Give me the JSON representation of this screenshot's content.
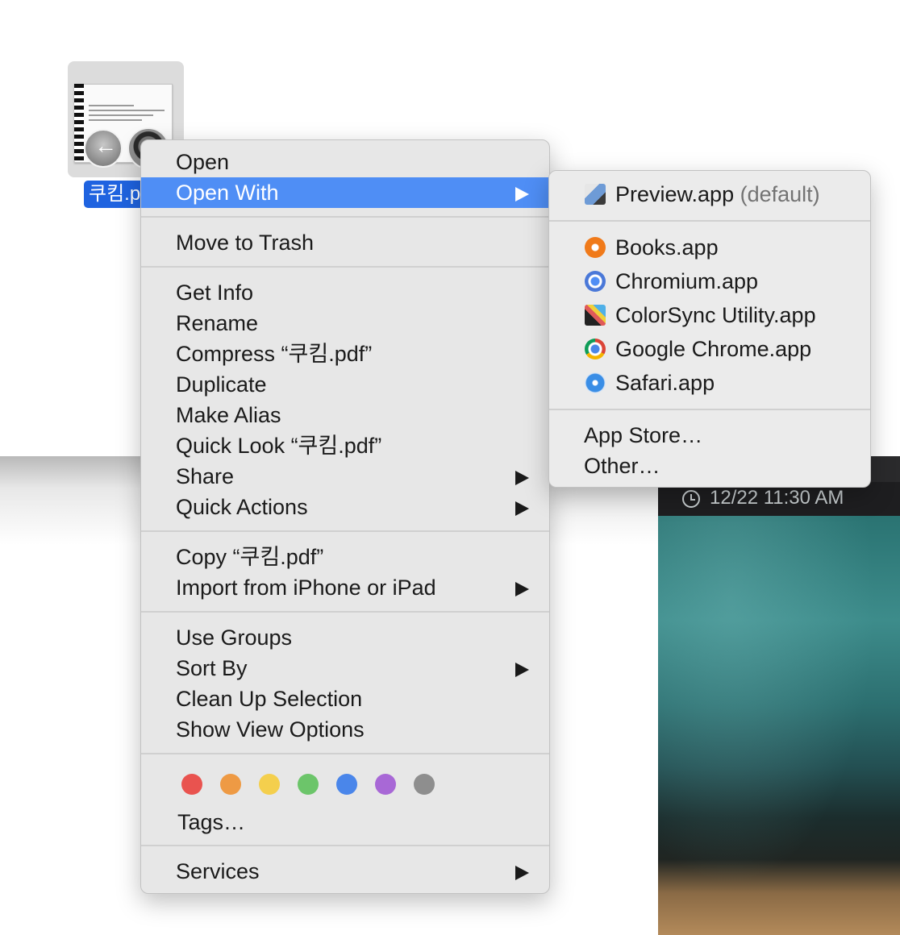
{
  "desktop": {
    "file": {
      "name_visible": "쿠킴.p"
    },
    "photo_window": {
      "timestamp": "12/22 11:30 AM"
    }
  },
  "context_menu": {
    "groups": [
      [
        {
          "label": "Open",
          "submenu": false,
          "highlighted": false
        },
        {
          "label": "Open With",
          "submenu": true,
          "highlighted": true
        }
      ],
      [
        {
          "label": "Move to Trash",
          "submenu": false,
          "highlighted": false
        }
      ],
      [
        {
          "label": "Get Info",
          "submenu": false,
          "highlighted": false
        },
        {
          "label": "Rename",
          "submenu": false,
          "highlighted": false
        },
        {
          "label": "Compress “쿠킴.pdf”",
          "submenu": false,
          "highlighted": false
        },
        {
          "label": "Duplicate",
          "submenu": false,
          "highlighted": false
        },
        {
          "label": "Make Alias",
          "submenu": false,
          "highlighted": false
        },
        {
          "label": "Quick Look “쿠킴.pdf”",
          "submenu": false,
          "highlighted": false
        },
        {
          "label": "Share",
          "submenu": true,
          "highlighted": false
        },
        {
          "label": "Quick Actions",
          "submenu": true,
          "highlighted": false
        }
      ],
      [
        {
          "label": "Copy “쿠킴.pdf”",
          "submenu": false,
          "highlighted": false
        },
        {
          "label": "Import from iPhone or iPad",
          "submenu": true,
          "highlighted": false
        }
      ],
      [
        {
          "label": "Use Groups",
          "submenu": false,
          "highlighted": false
        },
        {
          "label": "Sort By",
          "submenu": true,
          "highlighted": false
        },
        {
          "label": "Clean Up Selection",
          "submenu": false,
          "highlighted": false
        },
        {
          "label": "Show View Options",
          "submenu": false,
          "highlighted": false
        }
      ]
    ],
    "tags": {
      "colors": [
        "#e9534f",
        "#ee9a44",
        "#f4cf4d",
        "#6cc56a",
        "#4a86ea",
        "#a868d6",
        "#8e8e8e"
      ],
      "label": "Tags…"
    },
    "services": {
      "label": "Services",
      "submenu": true
    }
  },
  "open_with_submenu": {
    "default_app": {
      "name": "Preview.app",
      "note": "(default)",
      "icon": "preview-icon"
    },
    "apps": [
      {
        "name": "Books.app",
        "icon": "books-icon"
      },
      {
        "name": "Chromium.app",
        "icon": "chromium-icon"
      },
      {
        "name": "ColorSync Utility.app",
        "icon": "colorsync-icon"
      },
      {
        "name": "Google Chrome.app",
        "icon": "chrome-icon"
      },
      {
        "name": "Safari.app",
        "icon": "safari-icon"
      }
    ],
    "extra": [
      "App Store…",
      "Other…"
    ]
  }
}
